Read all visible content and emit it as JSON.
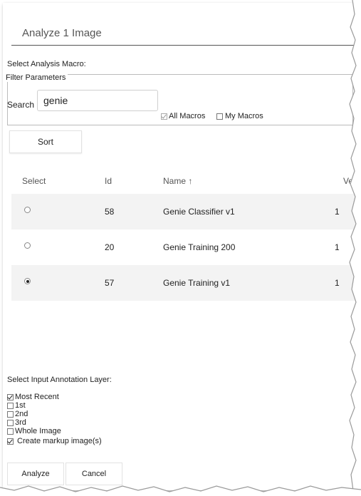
{
  "dialog": {
    "title": "Analyze 1 Image"
  },
  "macro_section": {
    "label": "Select Analysis Macro:"
  },
  "filter": {
    "legend": "Filter Parameters",
    "search_label": "Search",
    "search_value": "genie",
    "all_macros_label": "All Macros",
    "all_macros_checked": true,
    "my_macros_label": "My Macros",
    "my_macros_checked": false
  },
  "sort_button": {
    "label": "Sort"
  },
  "table": {
    "columns": [
      "Select",
      "Id",
      "Name ↑",
      "Version"
    ],
    "rows": [
      {
        "selected": false,
        "id": "58",
        "name": "Genie Classifier v1",
        "version": "1"
      },
      {
        "selected": false,
        "id": "20",
        "name": "Genie Training 200",
        "version": "1"
      },
      {
        "selected": true,
        "id": "57",
        "name": "Genie Training v1",
        "version": "1"
      }
    ]
  },
  "annotation": {
    "label": "Select Input Annotation Layer:",
    "options": [
      {
        "label": "Most Recent",
        "checked": true
      },
      {
        "label": "1st",
        "checked": false
      },
      {
        "label": "2nd",
        "checked": false
      },
      {
        "label": "3rd",
        "checked": false
      },
      {
        "label": "Whole Image",
        "checked": false
      },
      {
        "label": " Create markup image(s)",
        "checked": true
      }
    ]
  },
  "footer": {
    "analyze_label": "Analyze",
    "cancel_label": "Cancel"
  }
}
